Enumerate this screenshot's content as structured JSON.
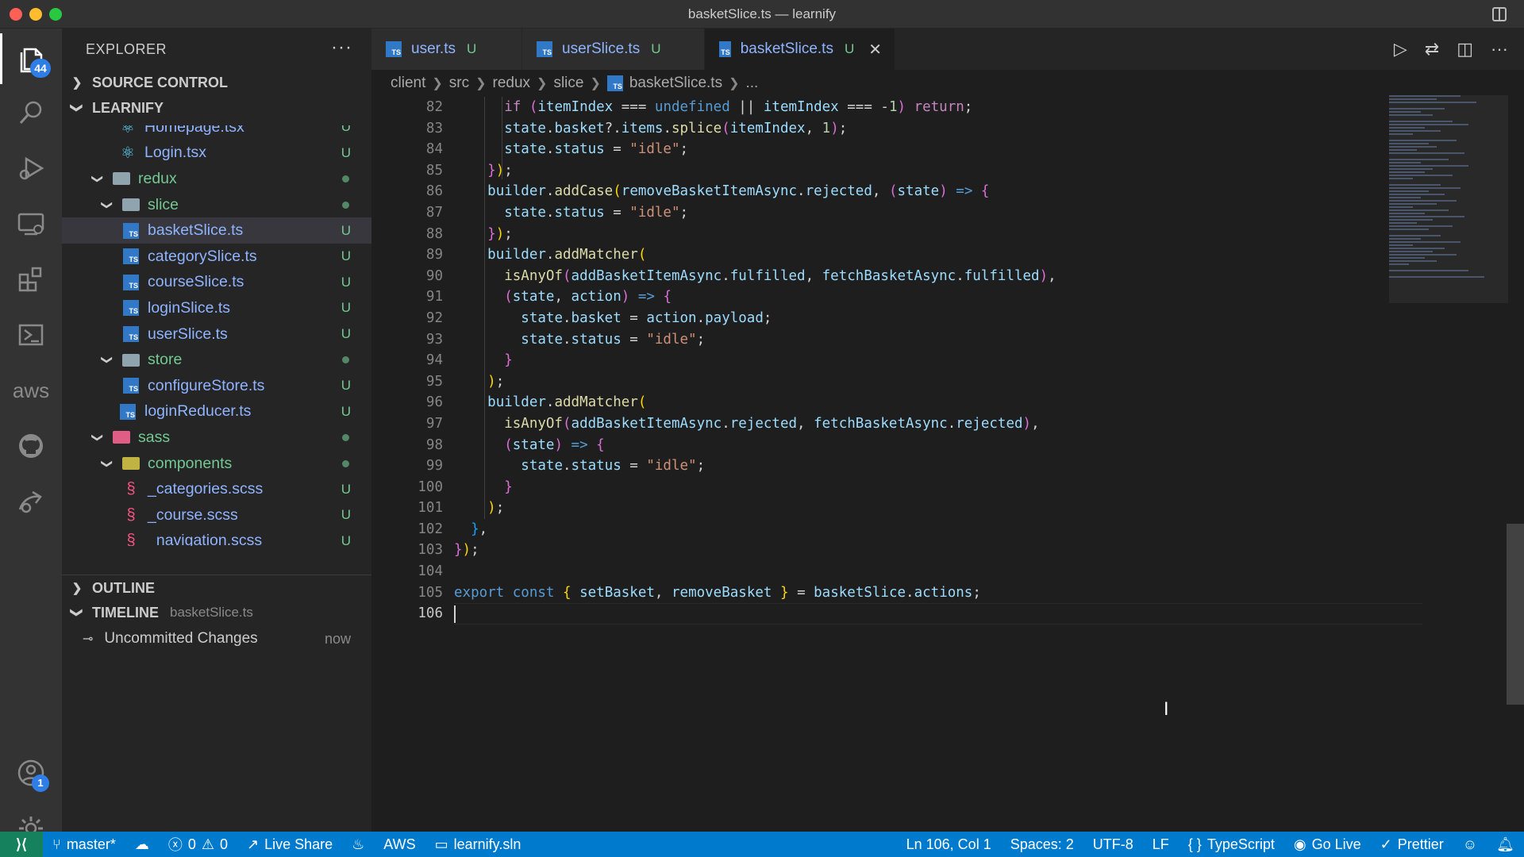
{
  "window": {
    "title": "basketSlice.ts — learnify"
  },
  "colors": {
    "accent": "#007acc",
    "sidebar_bg": "#252526",
    "editor_bg": "#1e1e1e",
    "git_untracked": "#73c991"
  },
  "activity_bar": {
    "explorer_badge": "44",
    "accounts_badge": "1",
    "aws_label": "aws",
    "icons": [
      "files-icon",
      "search-icon",
      "run-debug-icon",
      "remote-explorer-icon",
      "extensions-icon",
      "terminal-icon",
      "aws-icon",
      "github-icon",
      "remote-icon",
      "accounts-icon",
      "gear-icon"
    ]
  },
  "sidebar": {
    "title": "EXPLORER",
    "more": "···",
    "source_control": "SOURCE CONTROL",
    "project": "LEARNIFY",
    "tree": [
      {
        "name": "Homepage.tsx",
        "status": "U",
        "type": "react",
        "depth": 2
      },
      {
        "name": "Login.tsx",
        "status": "U",
        "type": "react",
        "depth": 2
      },
      {
        "name": "redux",
        "type": "folder",
        "depth": 1
      },
      {
        "name": "slice",
        "type": "folder",
        "depth": 2
      },
      {
        "name": "basketSlice.ts",
        "status": "U",
        "type": "ts",
        "depth": 3,
        "selected": true
      },
      {
        "name": "categorySlice.ts",
        "status": "U",
        "type": "ts",
        "depth": 3
      },
      {
        "name": "courseSlice.ts",
        "status": "U",
        "type": "ts",
        "depth": 3
      },
      {
        "name": "loginSlice.ts",
        "status": "U",
        "type": "ts",
        "depth": 3
      },
      {
        "name": "userSlice.ts",
        "status": "U",
        "type": "ts",
        "depth": 3
      },
      {
        "name": "store",
        "type": "folder",
        "depth": 2
      },
      {
        "name": "configureStore.ts",
        "status": "U",
        "type": "ts",
        "depth": 3
      },
      {
        "name": "loginReducer.ts",
        "status": "U",
        "type": "ts",
        "depth": 2
      },
      {
        "name": "sass",
        "type": "folder-sass",
        "depth": 1
      },
      {
        "name": "components",
        "type": "folder-comp",
        "depth": 2
      },
      {
        "name": "_categories.scss",
        "status": "U",
        "type": "scss",
        "depth": 3
      },
      {
        "name": "_course.scss",
        "status": "U",
        "type": "scss",
        "depth": 3
      },
      {
        "name": "_navigation.scss",
        "status": "U",
        "type": "scss",
        "depth": 3
      }
    ],
    "outline": "OUTLINE",
    "timeline": "TIMELINE",
    "timeline_file": "basketSlice.ts",
    "timeline_entry": "Uncommitted Changes",
    "timeline_time": "now"
  },
  "tabs": [
    {
      "name": "user.ts",
      "status": "U",
      "active": false
    },
    {
      "name": "userSlice.ts",
      "status": "U",
      "active": false
    },
    {
      "name": "basketSlice.ts",
      "status": "U",
      "active": true,
      "close": "✕"
    }
  ],
  "breadcrumb": [
    "client",
    "src",
    "redux",
    "slice",
    "basketSlice.ts",
    "..."
  ],
  "editor": {
    "line_numbers": [
      "82",
      "83",
      "84",
      "85",
      "86",
      "87",
      "88",
      "89",
      "90",
      "91",
      "92",
      "93",
      "94",
      "95",
      "96",
      "97",
      "98",
      "99",
      "100",
      "101",
      "102",
      "103",
      "104",
      "105",
      "106"
    ],
    "current_line": "106"
  },
  "statusbar": {
    "branch": "master*",
    "errors": "0",
    "warnings": "0",
    "live_share": "Live Share",
    "aws": "AWS",
    "solution": "learnify.sln",
    "position": "Ln 106, Col 1",
    "spaces": "Spaces: 2",
    "encoding": "UTF-8",
    "eol": "LF",
    "language": "TypeScript",
    "go_live": "Go Live",
    "prettier": "Prettier"
  }
}
